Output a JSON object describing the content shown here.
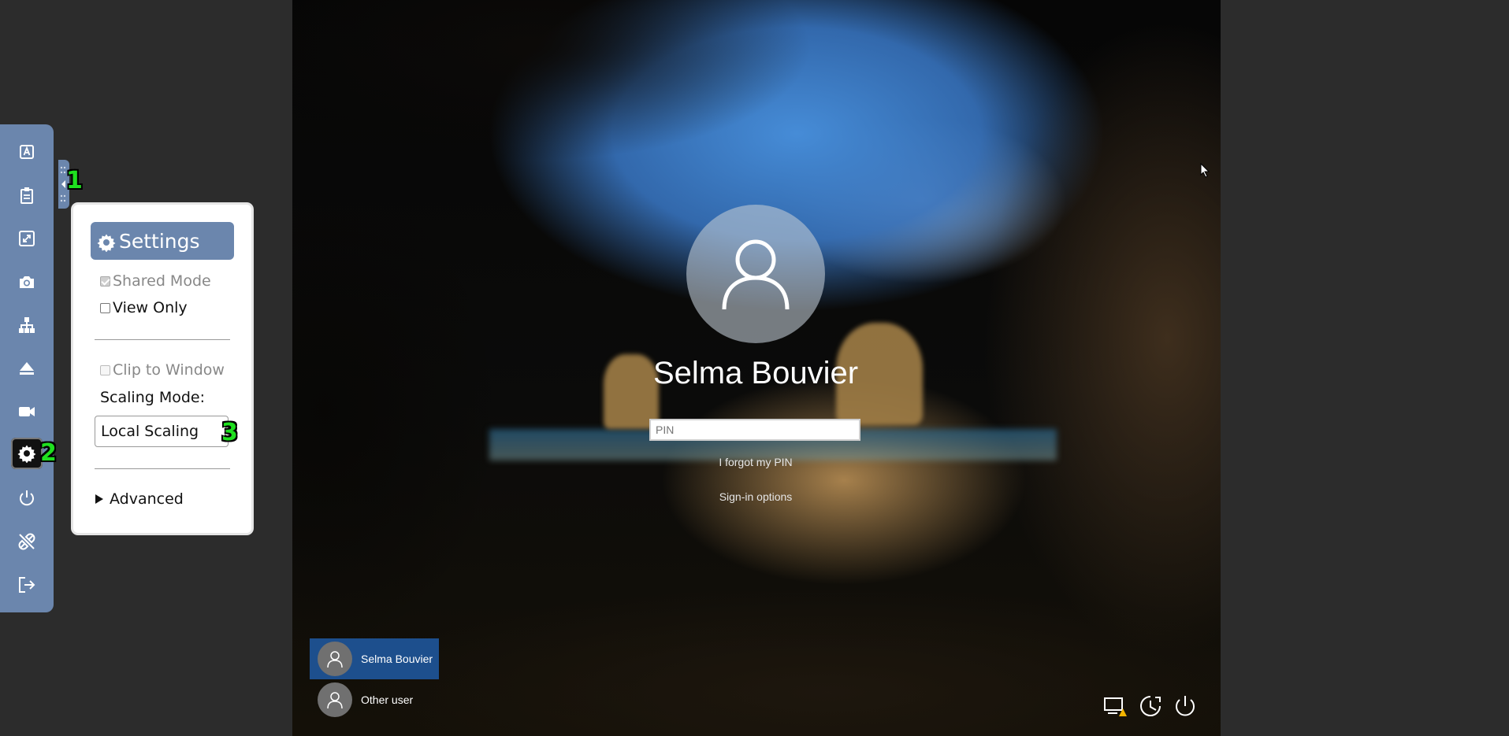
{
  "toolbar": {
    "buttons": [
      {
        "name": "keyboard-icon"
      },
      {
        "name": "clipboard-icon"
      },
      {
        "name": "fullscreen-icon"
      },
      {
        "name": "camera-icon"
      },
      {
        "name": "network-icon"
      },
      {
        "name": "eject-icon"
      },
      {
        "name": "video-camera-icon"
      },
      {
        "name": "gear-icon",
        "active": true
      },
      {
        "name": "power-icon"
      },
      {
        "name": "disconnect-icon"
      },
      {
        "name": "logout-icon"
      }
    ],
    "accent_color": "#6b86ad"
  },
  "markers": {
    "m1": "1",
    "m2": "2",
    "m3": "3"
  },
  "settings": {
    "title": "Settings",
    "shared_mode": {
      "label": "Shared Mode",
      "checked": true,
      "disabled": true
    },
    "view_only": {
      "label": "View Only",
      "checked": false
    },
    "clip_to_window": {
      "label": "Clip to Window",
      "checked": false,
      "disabled": true
    },
    "scaling_mode_label": "Scaling Mode:",
    "scaling_mode_value": "Local Scaling",
    "advanced_label": "Advanced"
  },
  "login": {
    "username": "Selma Bouvier",
    "pin_placeholder": "PIN",
    "forgot_pin": "I forgot my PIN",
    "signin_options": "Sign-in options",
    "users": [
      {
        "name": "Selma Bouvier",
        "selected": true
      },
      {
        "name": "Other user",
        "selected": false
      }
    ],
    "system_icons": [
      "network-warning-icon",
      "ease-of-access-icon",
      "power-icon"
    ]
  }
}
